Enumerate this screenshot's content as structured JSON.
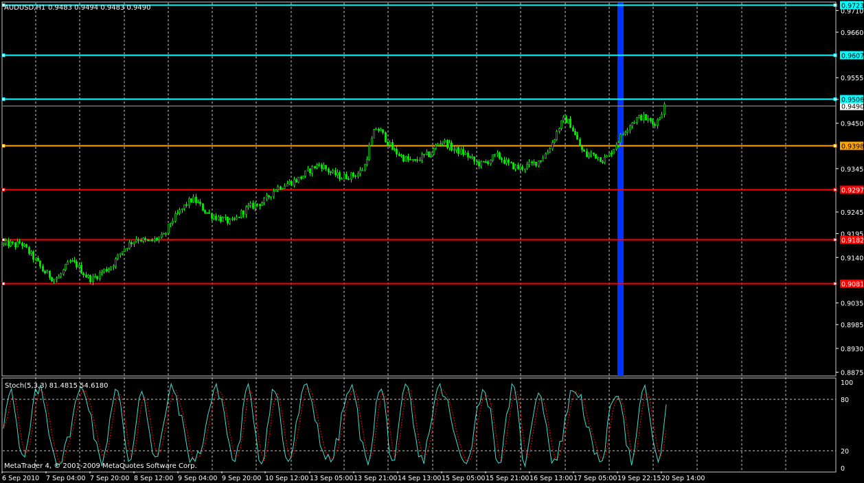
{
  "header": {
    "symbol": "AUDUSD,H1",
    "ohlc": "0.9483 0.9494 0.9483 0.9490"
  },
  "indicator": {
    "label": "Stoch(5,3,3) 81.4815 54.6180",
    "levels": [
      100,
      80,
      20,
      0
    ],
    "level_labels": [
      "100",
      "80",
      "20",
      "0"
    ]
  },
  "copyright": "MetaTrader 4, © 2001-2009 MetaQuotes Software Corp.",
  "colors": {
    "background": "#000000",
    "grid": "#c8c8c8",
    "candle": "#00ff00",
    "cyan_line": "#00ffff",
    "orange_line": "#ffa500",
    "red_line": "#ff0000",
    "highlight": "#0033ff",
    "stoch_main": "#40e0d0",
    "stoch_signal": "#ff0000",
    "axis_text": "#ffffff"
  },
  "chart_data": {
    "type": "candlestick",
    "symbol": "AUDUSD",
    "timeframe": "H1",
    "price_axis_ticks": [
      0.971,
      0.966,
      0.9555,
      0.9505,
      0.945,
      0.9345,
      0.9245,
      0.9195,
      0.914,
      0.9035,
      0.8985,
      0.893,
      0.8875
    ],
    "price_axis_tick_labels": [
      "0.9710",
      "0.9660",
      "0.9555",
      "0.9505",
      "0.9450",
      "0.9345",
      "0.9245",
      "0.9195",
      "0.9140",
      "0.9035",
      "0.8985",
      "0.8930",
      "0.8875"
    ],
    "ylim": [
      0.8868,
      0.9728
    ],
    "current_price": 0.949,
    "current_price_label": "0.9490",
    "horizontal_lines": [
      {
        "price": 0.9723,
        "label": "0.9723",
        "color": "cyan"
      },
      {
        "price": 0.9607,
        "label": "0.9607",
        "color": "cyan"
      },
      {
        "price": 0.9506,
        "label": "0.9506",
        "color": "cyan"
      },
      {
        "price": 0.9398,
        "label": "0.9398",
        "color": "orange"
      },
      {
        "price": 0.9297,
        "label": "0.9297",
        "color": "red"
      },
      {
        "price": 0.9182,
        "label": "0.9182",
        "color": "red"
      },
      {
        "price": 0.9081,
        "label": "0.9081",
        "color": "red"
      }
    ],
    "time_labels": [
      "6 Sep 2010",
      "7 Sep 04:00",
      "7 Sep 20:00",
      "8 Sep 12:00",
      "9 Sep 04:00",
      "9 Sep 20:00",
      "10 Sep 12:00",
      "13 Sep 05:00",
      "13 Sep 21:00",
      "14 Sep 13:00",
      "15 Sep 05:00",
      "15 Sep 21:00",
      "16 Sep 13:00",
      "17 Sep 05:00",
      "19 Sep 22:15",
      "20 Sep 14:00"
    ],
    "close_path": [
      0.917,
      0.9172,
      0.9168,
      0.9175,
      0.916,
      0.9145,
      0.913,
      0.911,
      0.91,
      0.909,
      0.9095,
      0.9115,
      0.913,
      0.9125,
      0.911,
      0.9095,
      0.909,
      0.91,
      0.911,
      0.9115,
      0.913,
      0.915,
      0.9165,
      0.9175,
      0.9185,
      0.918,
      0.9175,
      0.918,
      0.9185,
      0.919,
      0.922,
      0.9235,
      0.925,
      0.9265,
      0.9275,
      0.9265,
      0.925,
      0.924,
      0.9235,
      0.923,
      0.9225,
      0.922,
      0.923,
      0.9245,
      0.9255,
      0.926,
      0.9265,
      0.927,
      0.9285,
      0.93,
      0.9305,
      0.931,
      0.9315,
      0.932,
      0.933,
      0.934,
      0.935,
      0.9355,
      0.9345,
      0.9335,
      0.933,
      0.9325,
      0.9328,
      0.933,
      0.9335,
      0.935,
      0.94,
      0.944,
      0.943,
      0.941,
      0.939,
      0.938,
      0.937,
      0.9365,
      0.936,
      0.937,
      0.9375,
      0.938,
      0.94,
      0.941,
      0.94,
      0.939,
      0.9385,
      0.938,
      0.937,
      0.936,
      0.9355,
      0.936,
      0.937,
      0.9375,
      0.9365,
      0.9355,
      0.935,
      0.9345,
      0.935,
      0.9355,
      0.936,
      0.937,
      0.9385,
      0.941,
      0.944,
      0.946,
      0.945,
      0.942,
      0.939,
      0.9375,
      0.938,
      0.9372,
      0.9365,
      0.9375,
      0.9395,
      0.9415,
      0.9435,
      0.945,
      0.946,
      0.9465,
      0.9458,
      0.9448,
      0.946,
      0.949
    ]
  }
}
